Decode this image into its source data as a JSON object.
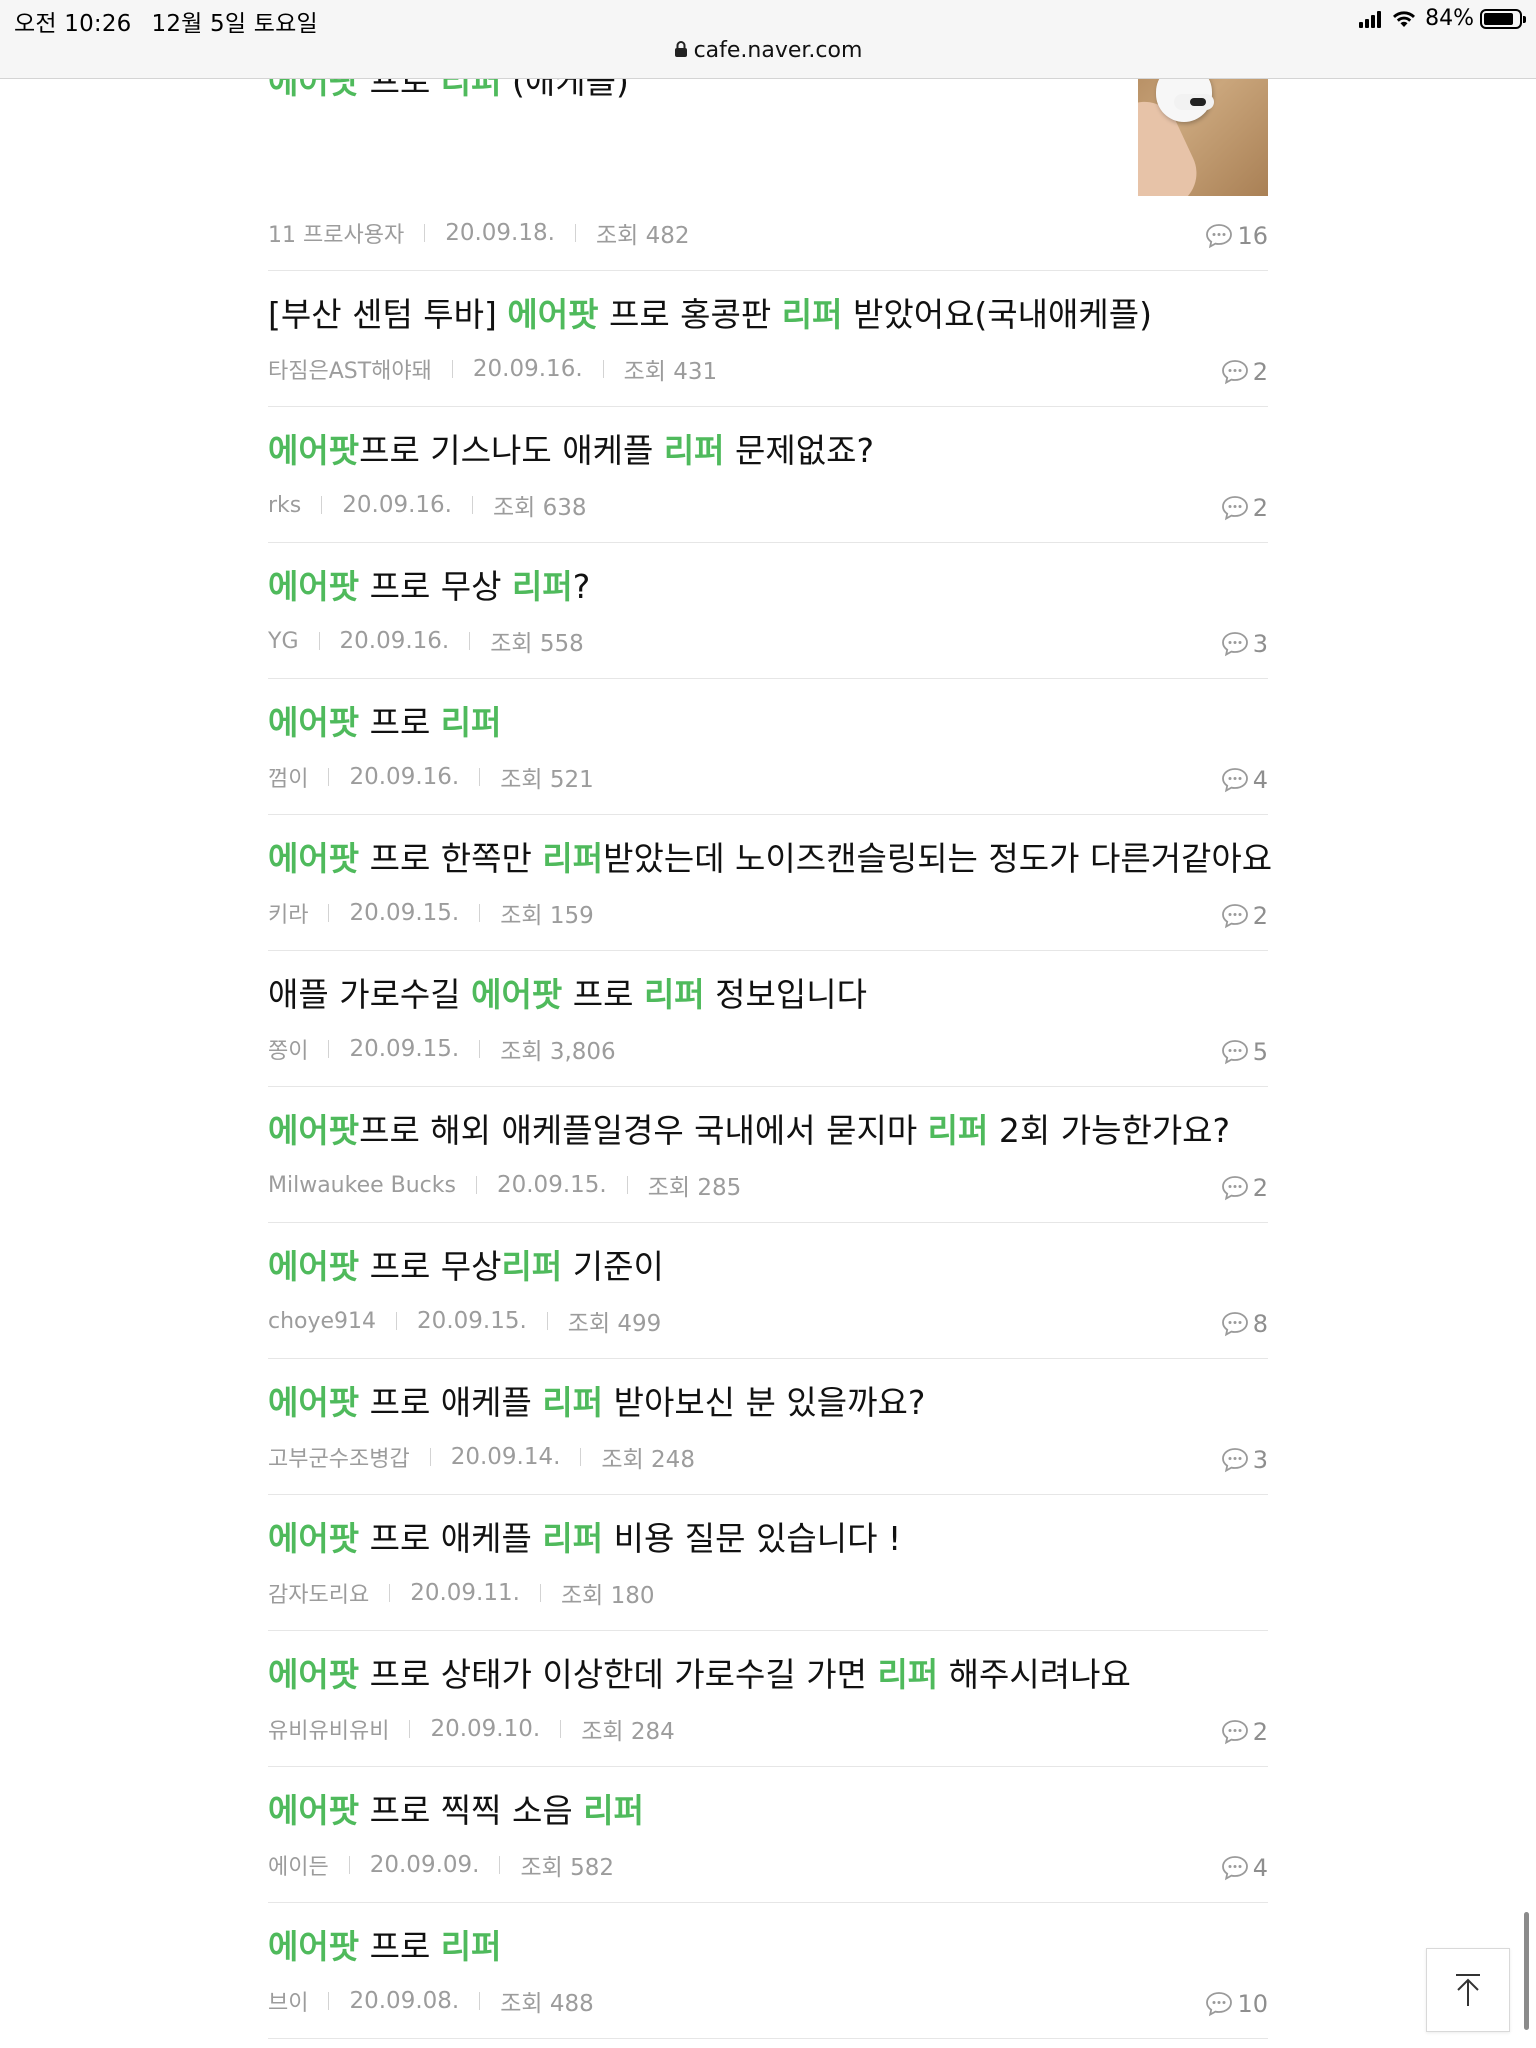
{
  "status_bar": {
    "time": "오전 10:26",
    "date": "12월 5일 토요일",
    "battery": "84%",
    "battery_level": 0.84
  },
  "url_bar": {
    "domain": "cafe.naver.com"
  },
  "first_post": {
    "title_parts": [
      "에어팟",
      " 프로 ",
      "리퍼",
      " (애케플)"
    ],
    "author": "11 프로사용자",
    "date": "20.09.18.",
    "views": "조회 482",
    "comments": "16"
  },
  "posts": [
    {
      "title_parts": [
        "[부산 센텀 투바] ",
        "에어팟",
        " 프로 홍콩판 ",
        "리퍼",
        " 받았어요(국내애케플)"
      ],
      "author": "타짐은AST해야돼",
      "date": "20.09.16.",
      "views": "조회 431",
      "comments": "2"
    },
    {
      "title_parts": [
        "",
        "에어팟",
        "프로 기스나도 애케플 ",
        "리퍼",
        " 문제없죠?"
      ],
      "author": "rks",
      "date": "20.09.16.",
      "views": "조회 638",
      "comments": "2"
    },
    {
      "title_parts": [
        "",
        "에어팟",
        " 프로 무상 ",
        "리퍼",
        "?"
      ],
      "author": "YG",
      "date": "20.09.16.",
      "views": "조회 558",
      "comments": "3"
    },
    {
      "title_parts": [
        "",
        "에어팟",
        " 프로 ",
        "리퍼",
        ""
      ],
      "author": "껌이",
      "date": "20.09.16.",
      "views": "조회 521",
      "comments": "4"
    },
    {
      "title_parts": [
        "",
        "에어팟",
        " 프로 한쪽만 ",
        "리퍼",
        "받았는데 노이즈캔슬링되는 정도가 다른거같아요"
      ],
      "author": "키라",
      "date": "20.09.15.",
      "views": "조회 159",
      "comments": "2"
    },
    {
      "title_parts": [
        "애플 가로수길 ",
        "에어팟",
        " 프로 ",
        "리퍼",
        " 정보입니다"
      ],
      "author": "쫑이",
      "date": "20.09.15.",
      "views": "조회 3,806",
      "comments": "5"
    },
    {
      "title_parts": [
        "",
        "에어팟",
        "프로 해외 애케플일경우 국내에서 묻지마 ",
        "리퍼",
        " 2회 가능한가요?"
      ],
      "author": "Milwaukee Bucks",
      "date": "20.09.15.",
      "views": "조회 285",
      "comments": "2"
    },
    {
      "title_parts": [
        "",
        "에어팟",
        " 프로 무상",
        "리퍼",
        " 기준이"
      ],
      "author": "choye914",
      "date": "20.09.15.",
      "views": "조회 499",
      "comments": "8"
    },
    {
      "title_parts": [
        "",
        "에어팟",
        " 프로 애케플 ",
        "리퍼",
        " 받아보신 분 있을까요?"
      ],
      "author": "고부군수조병갑",
      "date": "20.09.14.",
      "views": "조회 248",
      "comments": "3"
    },
    {
      "title_parts": [
        "",
        "에어팟",
        " 프로 애케플 ",
        "리퍼",
        " 비용 질문 있습니다 !"
      ],
      "author": "감자도리요",
      "date": "20.09.11.",
      "views": "조회 180",
      "comments": ""
    },
    {
      "title_parts": [
        "",
        "에어팟",
        " 프로 상태가 이상한데 가로수길 가면 ",
        "리퍼",
        " 해주시려나요"
      ],
      "author": "유비유비유비",
      "date": "20.09.10.",
      "views": "조회 284",
      "comments": "2"
    },
    {
      "title_parts": [
        "",
        "에어팟",
        " 프로 찍찍 소음 ",
        "리퍼",
        ""
      ],
      "author": "에이든",
      "date": "20.09.09.",
      "views": "조회 582",
      "comments": "4"
    },
    {
      "title_parts": [
        "",
        "에어팟",
        " 프로 ",
        "리퍼",
        ""
      ],
      "author": "브이",
      "date": "20.09.08.",
      "views": "조회 488",
      "comments": "10"
    }
  ],
  "colors": {
    "highlight": "#4fba5c",
    "meta_text": "#9c9c9c",
    "divider": "#e6e6e6"
  },
  "icons": {
    "comment": "comment-bubble-icon",
    "back_to_top": "arrow-up-icon",
    "secure": "lock-icon"
  }
}
